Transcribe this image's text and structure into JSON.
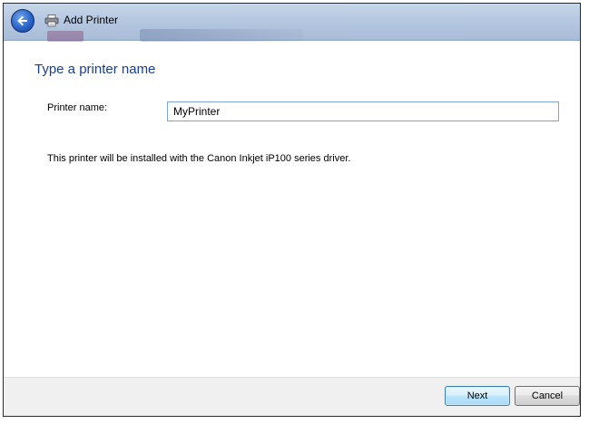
{
  "window": {
    "title": "Add Printer"
  },
  "titlebar": {
    "back_icon": "back-arrow-icon",
    "printer_icon": "printer-icon"
  },
  "content": {
    "heading": "Type a printer name",
    "printer_name_label": "Printer name:",
    "printer_name_value": "MyPrinter",
    "info_text": "This printer will be installed with the Canon Inkjet iP100 series driver."
  },
  "footer": {
    "next_label": "Next",
    "cancel_label": "Cancel"
  },
  "colors": {
    "heading": "#1a3e8c",
    "titlebar": "#b6c8e0",
    "footer": "#f0f0f0",
    "input_border": "#7fa6d3"
  }
}
